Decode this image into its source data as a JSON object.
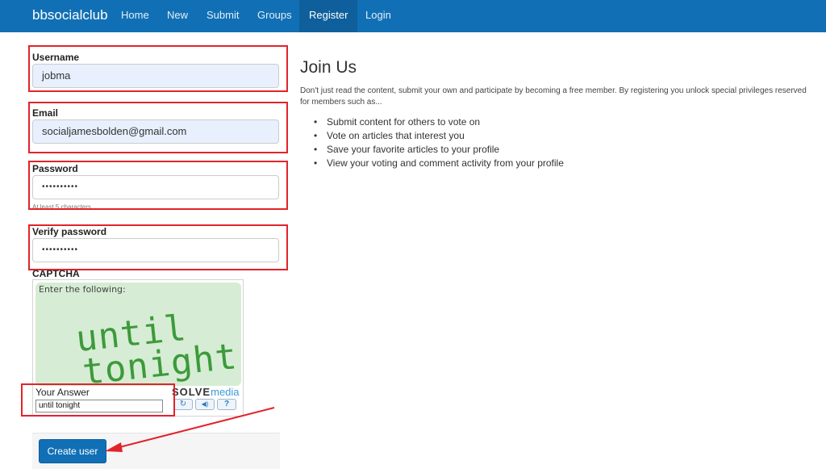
{
  "navbar": {
    "brand": "bbsocialclub",
    "items": [
      {
        "label": "Home"
      },
      {
        "label": "New"
      },
      {
        "label": "Submit"
      },
      {
        "label": "Groups"
      },
      {
        "label": "Register",
        "active": true
      },
      {
        "label": "Login"
      }
    ]
  },
  "form": {
    "username": {
      "label": "Username",
      "value": "jobma"
    },
    "email": {
      "label": "Email",
      "value": "socialjamesbolden@gmail.com"
    },
    "password": {
      "label": "Password",
      "value": "••••••••••",
      "help": "At least 5 characters"
    },
    "verify_password": {
      "label": "Verify password",
      "value": "••••••••••"
    },
    "captcha": {
      "label": "CAPTCHA",
      "prompt": "Enter the following:",
      "word1": "until",
      "word2": "tonight",
      "answer_label": "Your Answer",
      "answer_value": "until tonight",
      "logo_solve": "SOLVE",
      "logo_media": "media",
      "buttons": {
        "refresh": "↻",
        "audio": "◀)",
        "help": "?"
      }
    },
    "submit_label": "Create user"
  },
  "join": {
    "title": "Join Us",
    "text": "Don't just read the content, submit your own and participate by becoming a free member. By registering you unlock special privileges reserved for members such as...",
    "benefits": [
      "Submit content for others to vote on",
      "Vote on articles that interest you",
      "Save your favorite articles to your profile",
      "View your voting and comment activity from your profile"
    ]
  },
  "colors": {
    "navbar": "#1170b5",
    "annotation": "#e2232a",
    "button": "#1170b5",
    "captcha_text": "#3c9a3a"
  }
}
